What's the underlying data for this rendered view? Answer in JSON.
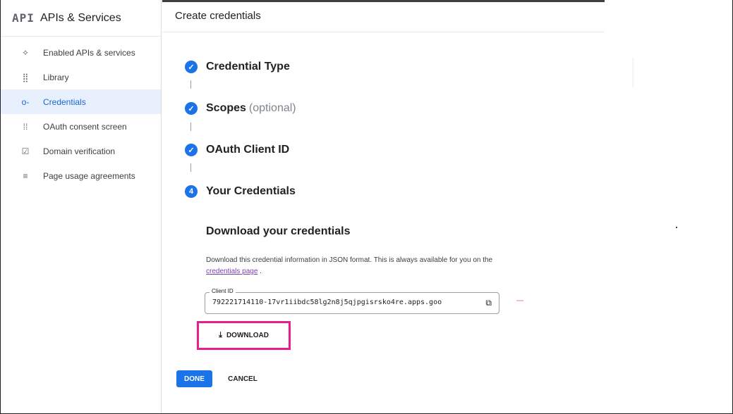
{
  "sidebar": {
    "logo": "API",
    "title": "APIs & Services",
    "items": [
      {
        "label": "Enabled APIs & services",
        "icon": "enabled-apis-icon",
        "glyph": "⟡"
      },
      {
        "label": "Library",
        "icon": "library-icon",
        "glyph": "⣿"
      },
      {
        "label": "Credentials",
        "icon": "key-icon",
        "glyph": "o-",
        "active": true
      },
      {
        "label": "OAuth consent screen",
        "icon": "oauth-consent-icon",
        "glyph": "⁞⁞"
      },
      {
        "label": "Domain verification",
        "icon": "domain-verification-icon",
        "glyph": "☑"
      },
      {
        "label": "Page usage agreements",
        "icon": "page-usage-icon",
        "glyph": "≡"
      }
    ]
  },
  "header": {
    "title": "Create credentials"
  },
  "steps": [
    {
      "number": "✓",
      "title": "Credential Type",
      "optional": ""
    },
    {
      "number": "✓",
      "title": "Scopes",
      "optional": "(optional)"
    },
    {
      "number": "✓",
      "title": "OAuth Client ID",
      "optional": ""
    },
    {
      "number": "4",
      "title": "Your Credentials",
      "optional": ""
    }
  ],
  "download_section": {
    "heading": "Download your credentials",
    "description_before": "Download this credential information in JSON format. This is always available for you on the ",
    "link_text": "credentials page",
    "description_after": " .",
    "client_id_label": "Client ID",
    "client_id_value": "792221714110-17vr1iibdc58lg2n8j5qjpgisrsko4re.apps.goo",
    "download_label": "DOWNLOAD"
  },
  "actions": {
    "done_label": "DONE",
    "cancel_label": "CANCEL"
  },
  "colors": {
    "accent": "#1a73e8",
    "active_bg": "#e8f0fe",
    "highlight": "#e91e8c",
    "link": "#7b3fb3"
  }
}
